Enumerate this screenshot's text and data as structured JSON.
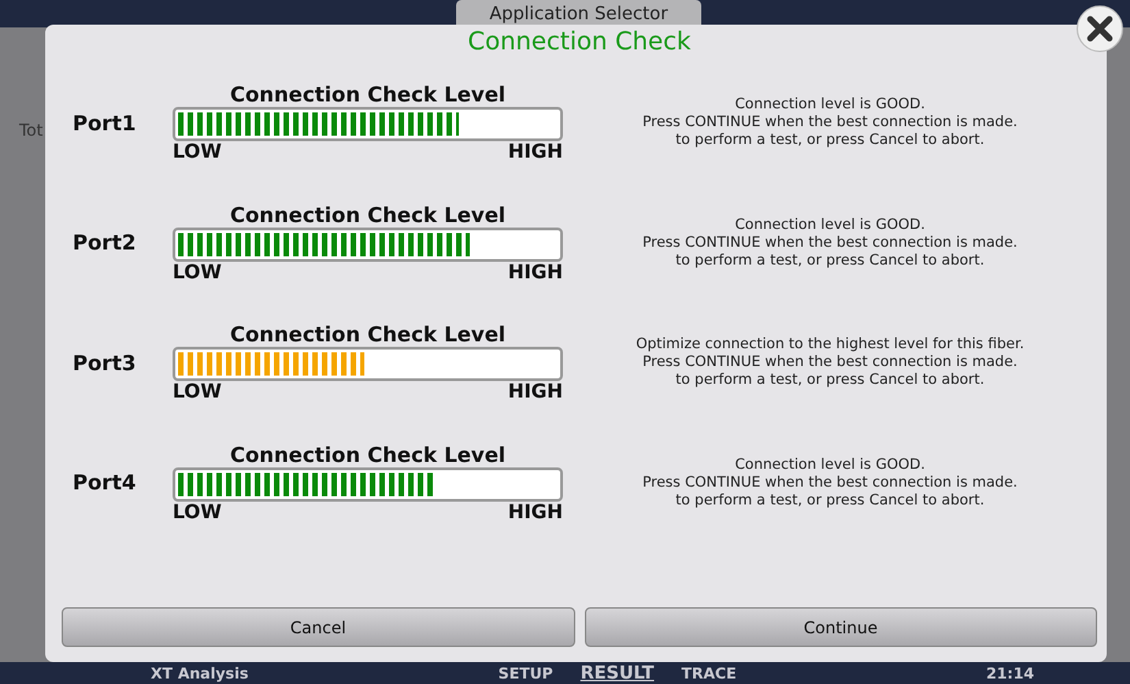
{
  "background": {
    "tab": "Application Selector",
    "side_label": "Tot",
    "status_bar": {
      "app": "XT Analysis",
      "tabs": [
        {
          "label": "SETUP",
          "selected": false
        },
        {
          "label": "RESULT",
          "selected": true
        },
        {
          "label": "TRACE",
          "selected": false
        }
      ],
      "time": "21:14"
    }
  },
  "dialog": {
    "title": "Connection Check",
    "ports": [
      {
        "label": "Port1",
        "heading": "Connection Check Level",
        "level": 0.74,
        "color": "#0a8a0a",
        "low": "LOW",
        "high": "HIGH",
        "message": [
          "Connection level is GOOD.",
          "Press CONTINUE when the best connection is made.",
          "to perform a test, or press Cancel to abort."
        ]
      },
      {
        "label": "Port2",
        "heading": "Connection Check Level",
        "level": 0.77,
        "color": "#0a8a0a",
        "low": "LOW",
        "high": "HIGH",
        "message": [
          "Connection level is GOOD.",
          "Press CONTINUE when the best connection is made.",
          "to perform a test, or press Cancel to abort."
        ]
      },
      {
        "label": "Port3",
        "heading": "Connection Check Level",
        "level": 0.49,
        "color": "#f5a500",
        "low": "LOW",
        "high": "HIGH",
        "message": [
          "Optimize connection to the highest level for this fiber.",
          "Press CONTINUE when the best connection is made.",
          "to perform a test, or press Cancel to abort."
        ]
      },
      {
        "label": "Port4",
        "heading": "Connection Check Level",
        "level": 0.67,
        "color": "#0a8a0a",
        "low": "LOW",
        "high": "HIGH",
        "message": [
          "Connection level is GOOD.",
          "Press CONTINUE when the best connection is made.",
          "to perform a test, or press Cancel to abort."
        ]
      }
    ],
    "buttons": [
      "Cancel",
      "Continue"
    ]
  }
}
